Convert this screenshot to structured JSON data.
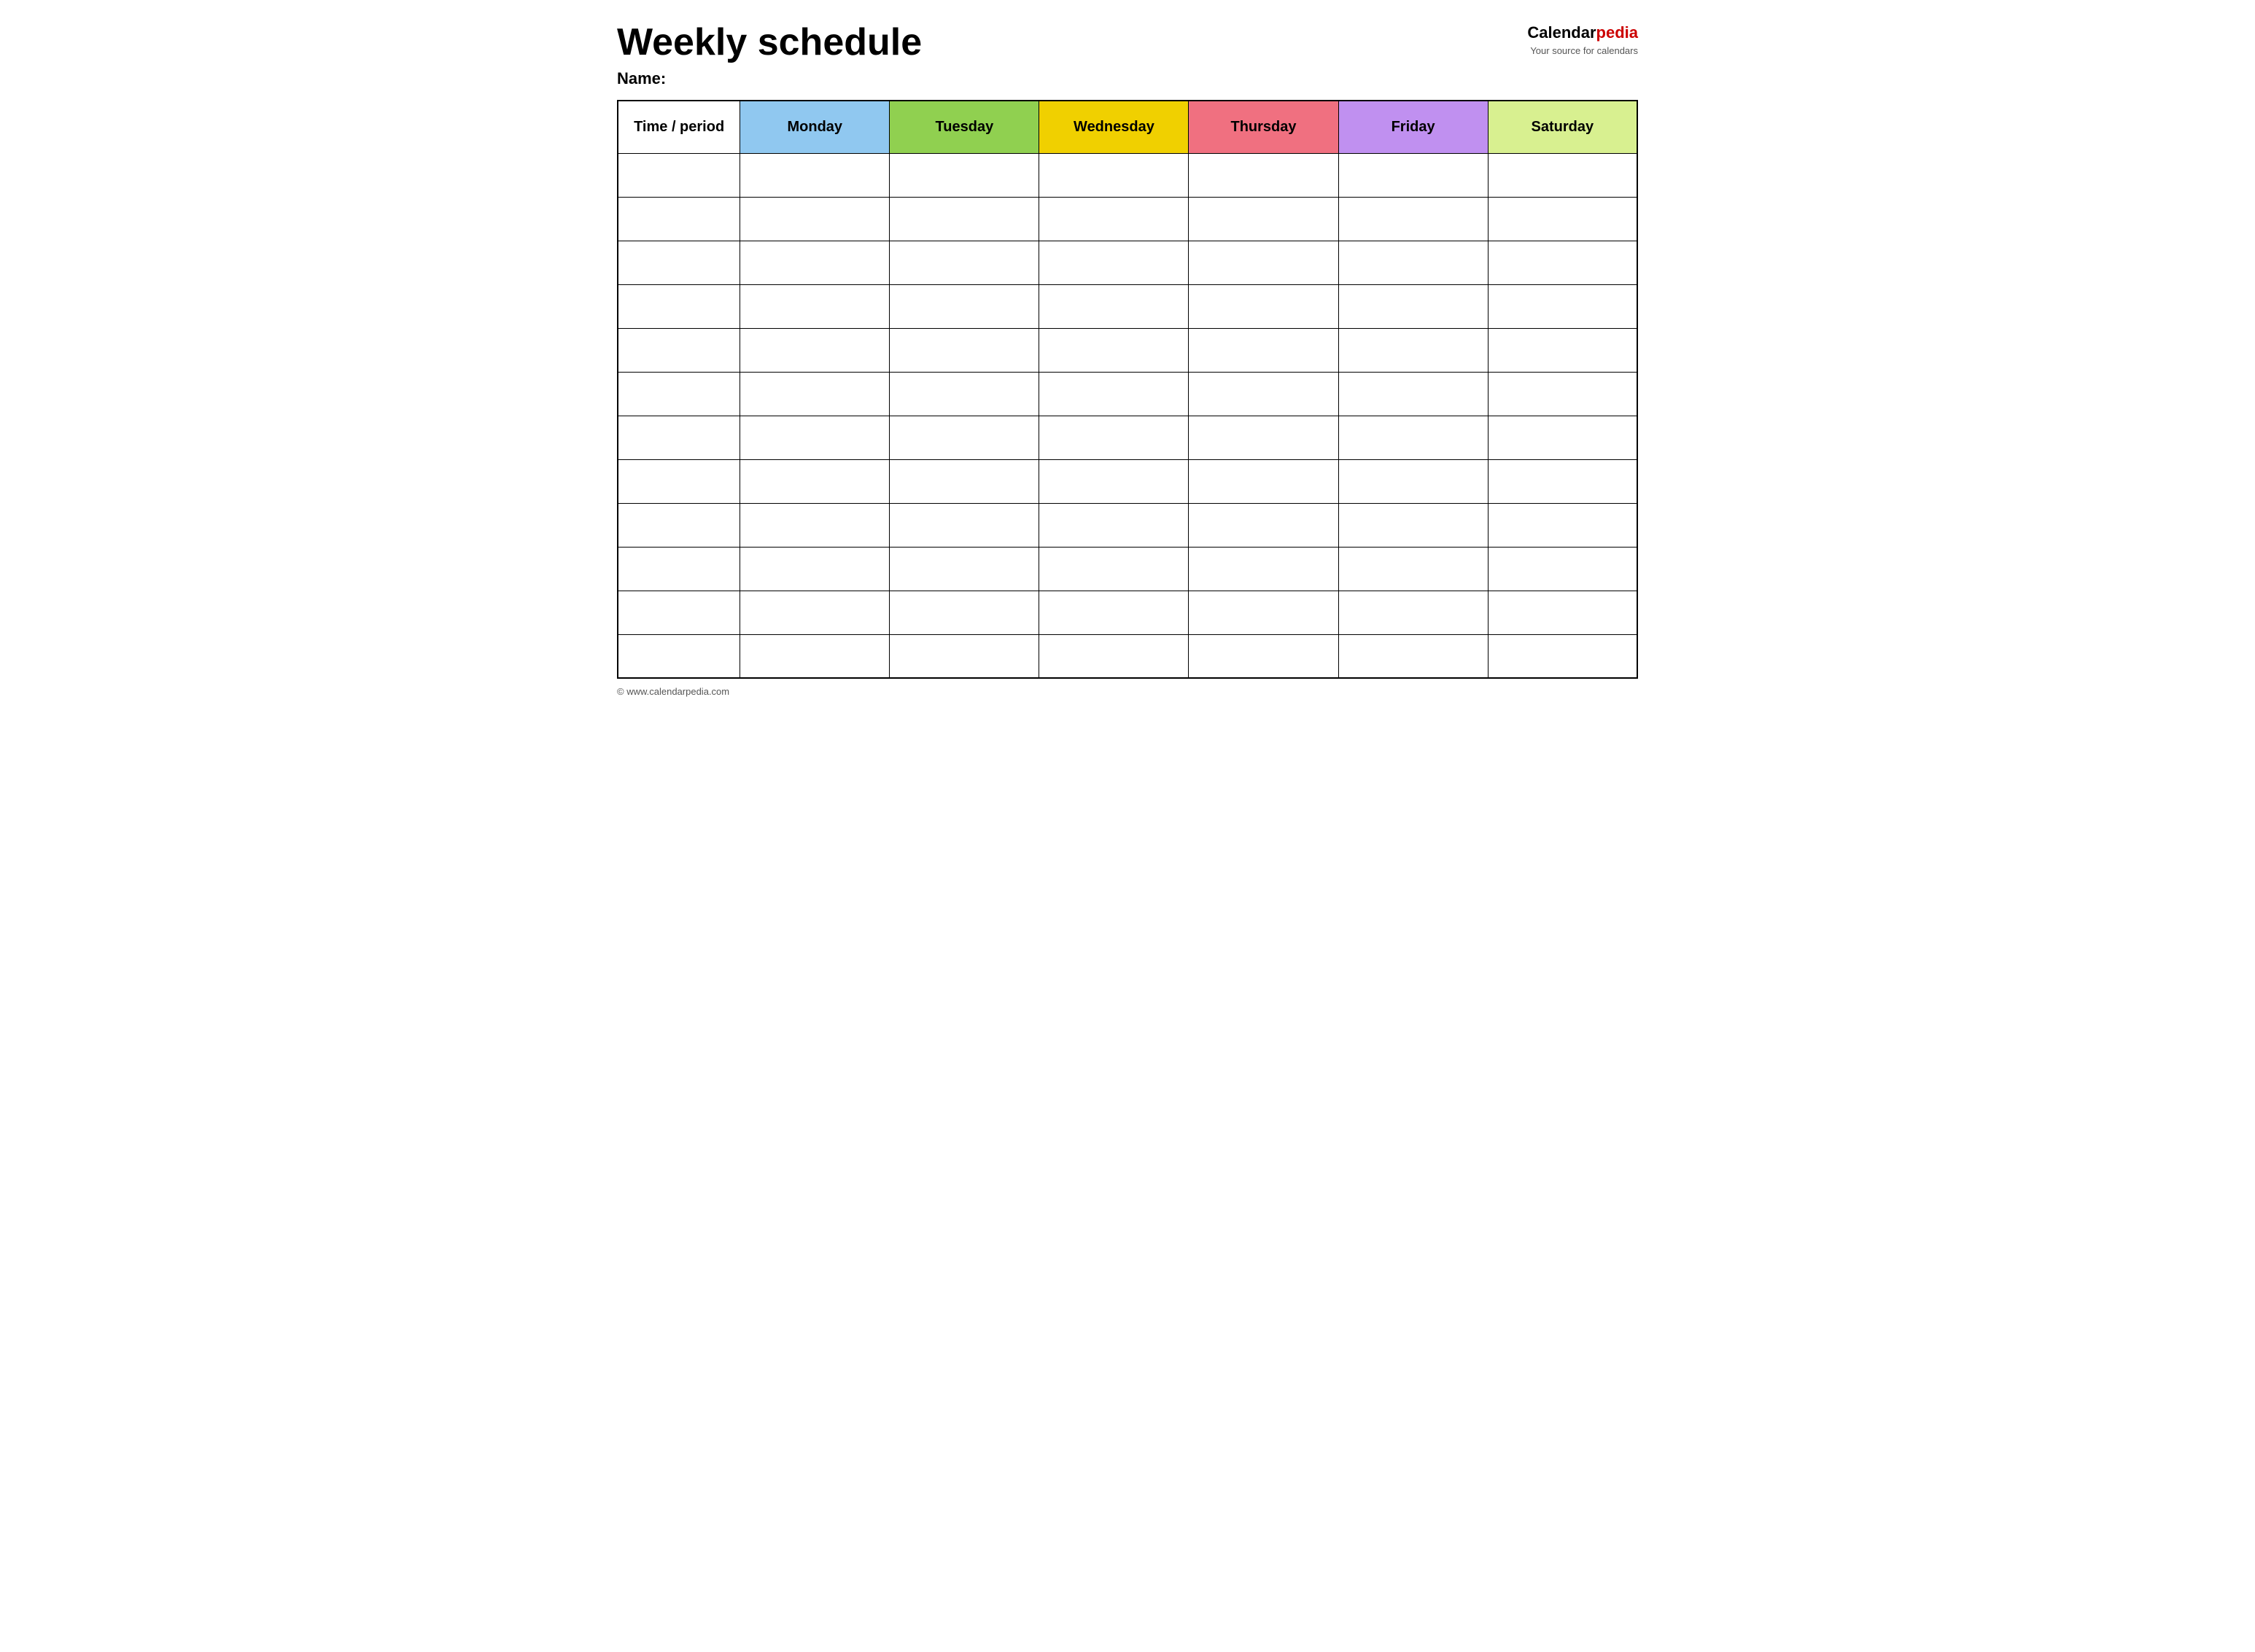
{
  "header": {
    "title": "Weekly schedule",
    "brand": {
      "calendar": "Calendar",
      "pedia": "pedia",
      "tagline": "Your source for calendars"
    },
    "name_label": "Name:"
  },
  "table": {
    "columns": [
      {
        "id": "time",
        "label": "Time / period",
        "class": "th-time"
      },
      {
        "id": "monday",
        "label": "Monday",
        "class": "th-monday"
      },
      {
        "id": "tuesday",
        "label": "Tuesday",
        "class": "th-tuesday"
      },
      {
        "id": "wednesday",
        "label": "Wednesday",
        "class": "th-wednesday"
      },
      {
        "id": "thursday",
        "label": "Thursday",
        "class": "th-thursday"
      },
      {
        "id": "friday",
        "label": "Friday",
        "class": "th-friday"
      },
      {
        "id": "saturday",
        "label": "Saturday",
        "class": "th-saturday"
      }
    ],
    "row_count": 12
  },
  "footer": {
    "url": "www.calendarpedia.com",
    "text": "© www.calendarpedia.com"
  }
}
